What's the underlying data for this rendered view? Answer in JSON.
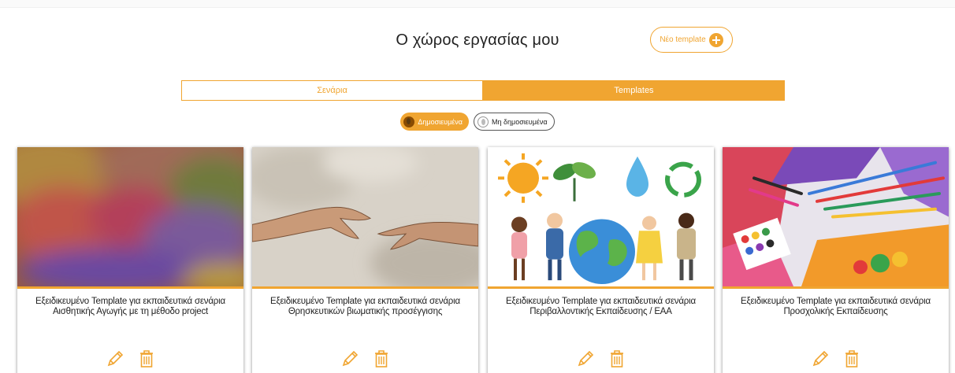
{
  "header": {
    "title": "Ο χώρος εργασίας μου",
    "new_template_label": "Νέο template"
  },
  "tabs": [
    {
      "label": "Σενάρια",
      "active": false
    },
    {
      "label": "Templates",
      "active": true
    }
  ],
  "filters": [
    {
      "label": "Δημοσιευμένα",
      "active": true
    },
    {
      "label": "Μη δημοσιευμένα",
      "active": false
    }
  ],
  "cards": [
    {
      "title": "Εξειδικευμένο Template για εκπαιδευτικά σενάρια Αισθητικής Αγωγής με τη μέθοδο project",
      "image": "watercolor-abstract"
    },
    {
      "title": "Εξειδικευμένο Template για εκπαιδευτικά σενάρια Θρησκευτικών βιωματικής προσέγγισης",
      "image": "creation-of-adam-hands"
    },
    {
      "title": "Εξειδικευμένο Template για εκπαιδευτικά σενάρια Περιβαλλοντικής Εκπαίδευσης / ΕΑΑ",
      "image": "children-earth-illustration"
    },
    {
      "title": "Εξειδικευμένο Template για εκπαιδευτικά σενάρια Προσχολικής Εκπαίδευσης",
      "image": "art-supplies"
    }
  ],
  "colors": {
    "accent": "#f0a531"
  }
}
